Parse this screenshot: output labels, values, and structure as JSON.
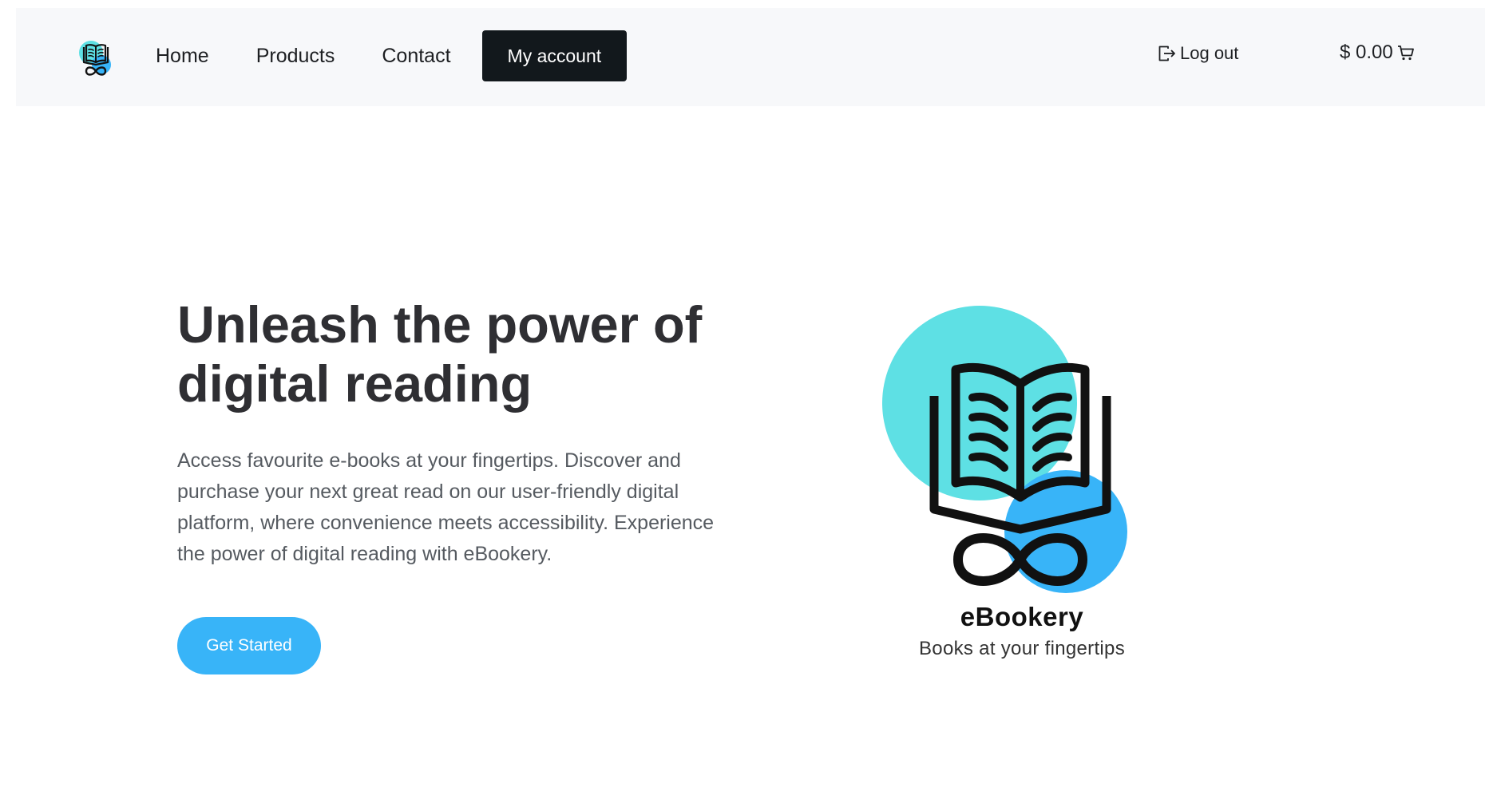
{
  "nav": {
    "logo_icon": "ebookery-logo-icon",
    "links": [
      "Home",
      "Products",
      "Contact"
    ],
    "account_label": "My account",
    "logout_label": "Log out",
    "logout_icon": "logout-icon",
    "cart_total": "$ 0.00",
    "cart_icon": "cart-icon"
  },
  "hero": {
    "title": "Unleash the power of digital reading",
    "description": "Access favourite e-books at your fingertips. Discover and purchase your next great read on our user-friendly digital platform, where convenience meets accessibility. Experience the power of digital reading with eBookery.",
    "cta_label": "Get Started"
  },
  "brand": {
    "name": "eBookery",
    "tagline": "Books at your fingertips"
  },
  "colors": {
    "accent_blue": "#38b4f8",
    "accent_teal": "#5ee0e4",
    "nav_background": "#f7f8fa",
    "account_button": "#12181c"
  }
}
